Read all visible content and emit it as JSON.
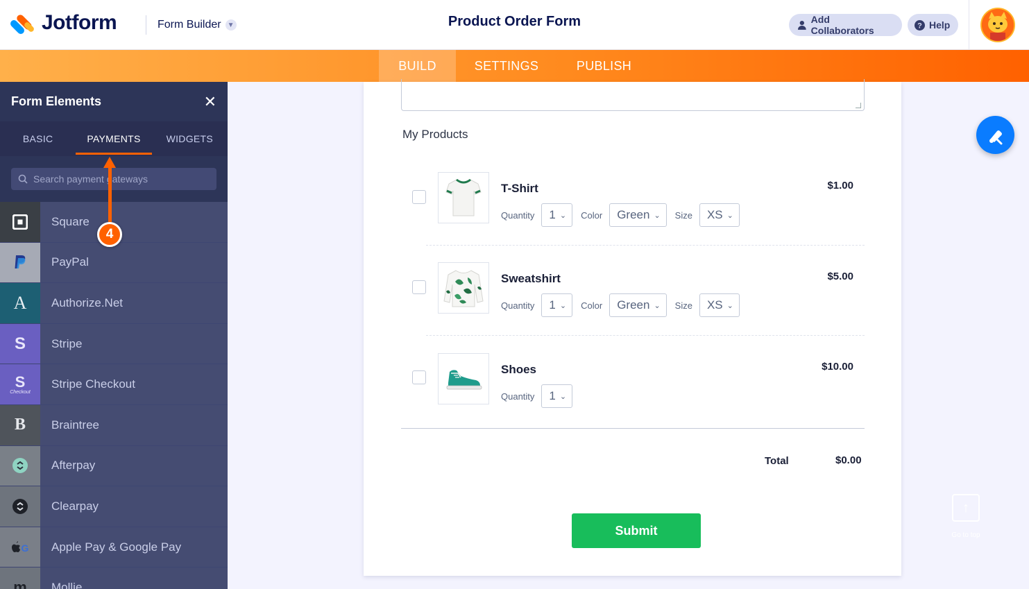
{
  "header": {
    "logo_text": "Jotform",
    "builder_menu": "Form Builder",
    "form_title": "Product Order Form",
    "add_collaborators": "Add Collaborators",
    "help": "Help"
  },
  "nav": {
    "tabs": [
      {
        "label": "BUILD",
        "active": true
      },
      {
        "label": "SETTINGS",
        "active": false
      },
      {
        "label": "PUBLISH",
        "active": false
      }
    ]
  },
  "sidebar": {
    "title": "Form Elements",
    "tabs": [
      {
        "label": "BASIC",
        "active": false
      },
      {
        "label": "PAYMENTS",
        "active": true
      },
      {
        "label": "WIDGETS",
        "active": false
      }
    ],
    "search_placeholder": "Search payment gateways",
    "items": [
      {
        "label": "Square",
        "icon": "square-icon",
        "icon_bg": "#3a3f45"
      },
      {
        "label": "PayPal",
        "icon": "paypal-icon",
        "icon_bg": "#a6aab5"
      },
      {
        "label": "Authorize.Net",
        "icon": "authorize-net-icon",
        "icon_bg": "#1d5f73"
      },
      {
        "label": "Stripe",
        "icon": "stripe-icon",
        "icon_bg": "#6a5fc1"
      },
      {
        "label": "Stripe Checkout",
        "icon": "stripe-checkout-icon",
        "icon_bg": "#6a5fc1",
        "sublabel": "Checkout"
      },
      {
        "label": "Braintree",
        "icon": "braintree-icon",
        "icon_bg": "#4f545b"
      },
      {
        "label": "Afterpay",
        "icon": "afterpay-icon",
        "icon_bg": "#7a8088"
      },
      {
        "label": "Clearpay",
        "icon": "clearpay-icon",
        "icon_bg": "#6e747d"
      },
      {
        "label": "Apple Pay & Google Pay",
        "icon": "apple-google-pay-icon",
        "icon_bg": "#7a7f88"
      },
      {
        "label": "Mollie",
        "icon": "mollie-icon",
        "icon_bg": "#6e747d"
      }
    ]
  },
  "form": {
    "section_label": "My Products",
    "products": [
      {
        "name": "T-Shirt",
        "price": "$1.00",
        "quantity_label": "Quantity",
        "quantity": "1",
        "color_label": "Color",
        "color": "Green",
        "size_label": "Size",
        "size": "XS"
      },
      {
        "name": "Sweatshirt",
        "price": "$5.00",
        "quantity_label": "Quantity",
        "quantity": "1",
        "color_label": "Color",
        "color": "Green",
        "size_label": "Size",
        "size": "XS"
      },
      {
        "name": "Shoes",
        "price": "$10.00",
        "quantity_label": "Quantity",
        "quantity": "1"
      }
    ],
    "total_label": "Total",
    "total_value": "$0.00",
    "submit_label": "Submit"
  },
  "goto_top_label": "Go to top",
  "annotation": {
    "step": "4"
  },
  "colors": {
    "accent": "#ff6100",
    "submit": "#18bd5b",
    "sidebar_bg": "#343c6a",
    "float_button": "#0a7cff"
  }
}
